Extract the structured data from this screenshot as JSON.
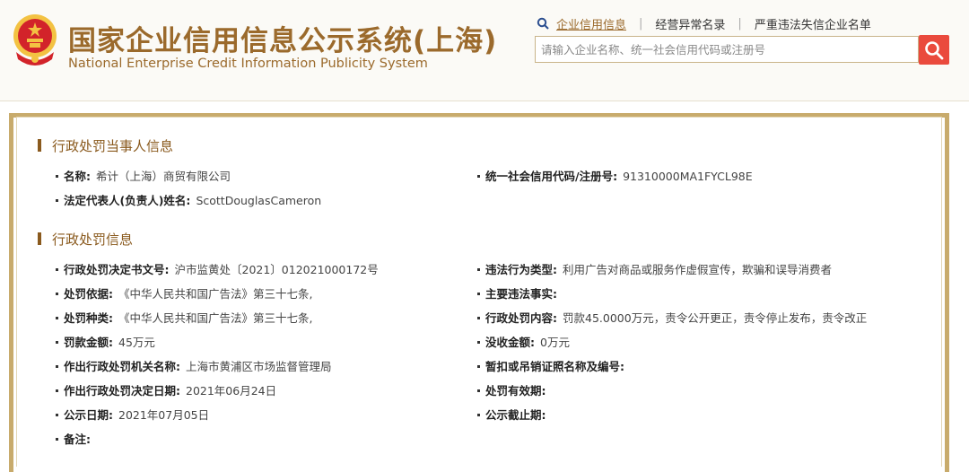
{
  "header": {
    "title_cn": "国家企业信用信息公示系统(上海)",
    "title_en": "National Enterprise Credit Information Publicity System",
    "nav": [
      {
        "label": "企业信用信息"
      },
      {
        "label": "经营异常名录"
      },
      {
        "label": "严重违法失信企业名单"
      }
    ],
    "search": {
      "placeholder": "请输入企业名称、统一社会信用代码或注册号",
      "value": ""
    }
  },
  "party": {
    "title": "行政处罚当事人信息",
    "name_label": "名称:",
    "name_value": "希计（上海）商贸有限公司",
    "credit_label": "统一社会信用代码/注册号:",
    "credit_value": "91310000MA1FYCL98E",
    "rep_label": "法定代表人(负责人)姓名:",
    "rep_value": "ScottDouglasCameron"
  },
  "penalty": {
    "title": "行政处罚信息",
    "left": [
      {
        "label": "行政处罚决定书文号:",
        "value": "沪市监黄处〔2021〕012021000172号"
      },
      {
        "label": "处罚依据:",
        "value": "《中华人民共和国广告法》第三十七条,"
      },
      {
        "label": "处罚种类:",
        "value": "《中华人民共和国广告法》第三十七条,"
      },
      {
        "label": "罚款金额:",
        "value": "45万元"
      },
      {
        "label": "作出行政处罚机关名称:",
        "value": "上海市黄浦区市场监督管理局"
      },
      {
        "label": "作出行政处罚决定日期:",
        "value": "2021年06月24日"
      },
      {
        "label": "公示日期:",
        "value": "2021年07月05日"
      },
      {
        "label": "备注:",
        "value": ""
      }
    ],
    "right": [
      {
        "label": "违法行为类型:",
        "value": "利用广告对商品或服务作虚假宣传，欺骗和误导消费者"
      },
      {
        "label": "主要违法事实:",
        "value": ""
      },
      {
        "label": "行政处罚内容:",
        "value": "罚款45.0000万元，责令公开更正，责令停止发布，责令改正"
      },
      {
        "label": "没收金额:",
        "value": "0万元"
      },
      {
        "label": "暂扣或吊销证照名称及编号:",
        "value": ""
      },
      {
        "label": "处罚有效期:",
        "value": ""
      },
      {
        "label": "公示截止期:",
        "value": ""
      }
    ]
  },
  "colors": {
    "brand": "#9b6a2c",
    "frame": "#c8ab6c",
    "search_button": "#ea4a3d",
    "emblem_red": "#d2232a",
    "emblem_gold": "#f3c242"
  }
}
